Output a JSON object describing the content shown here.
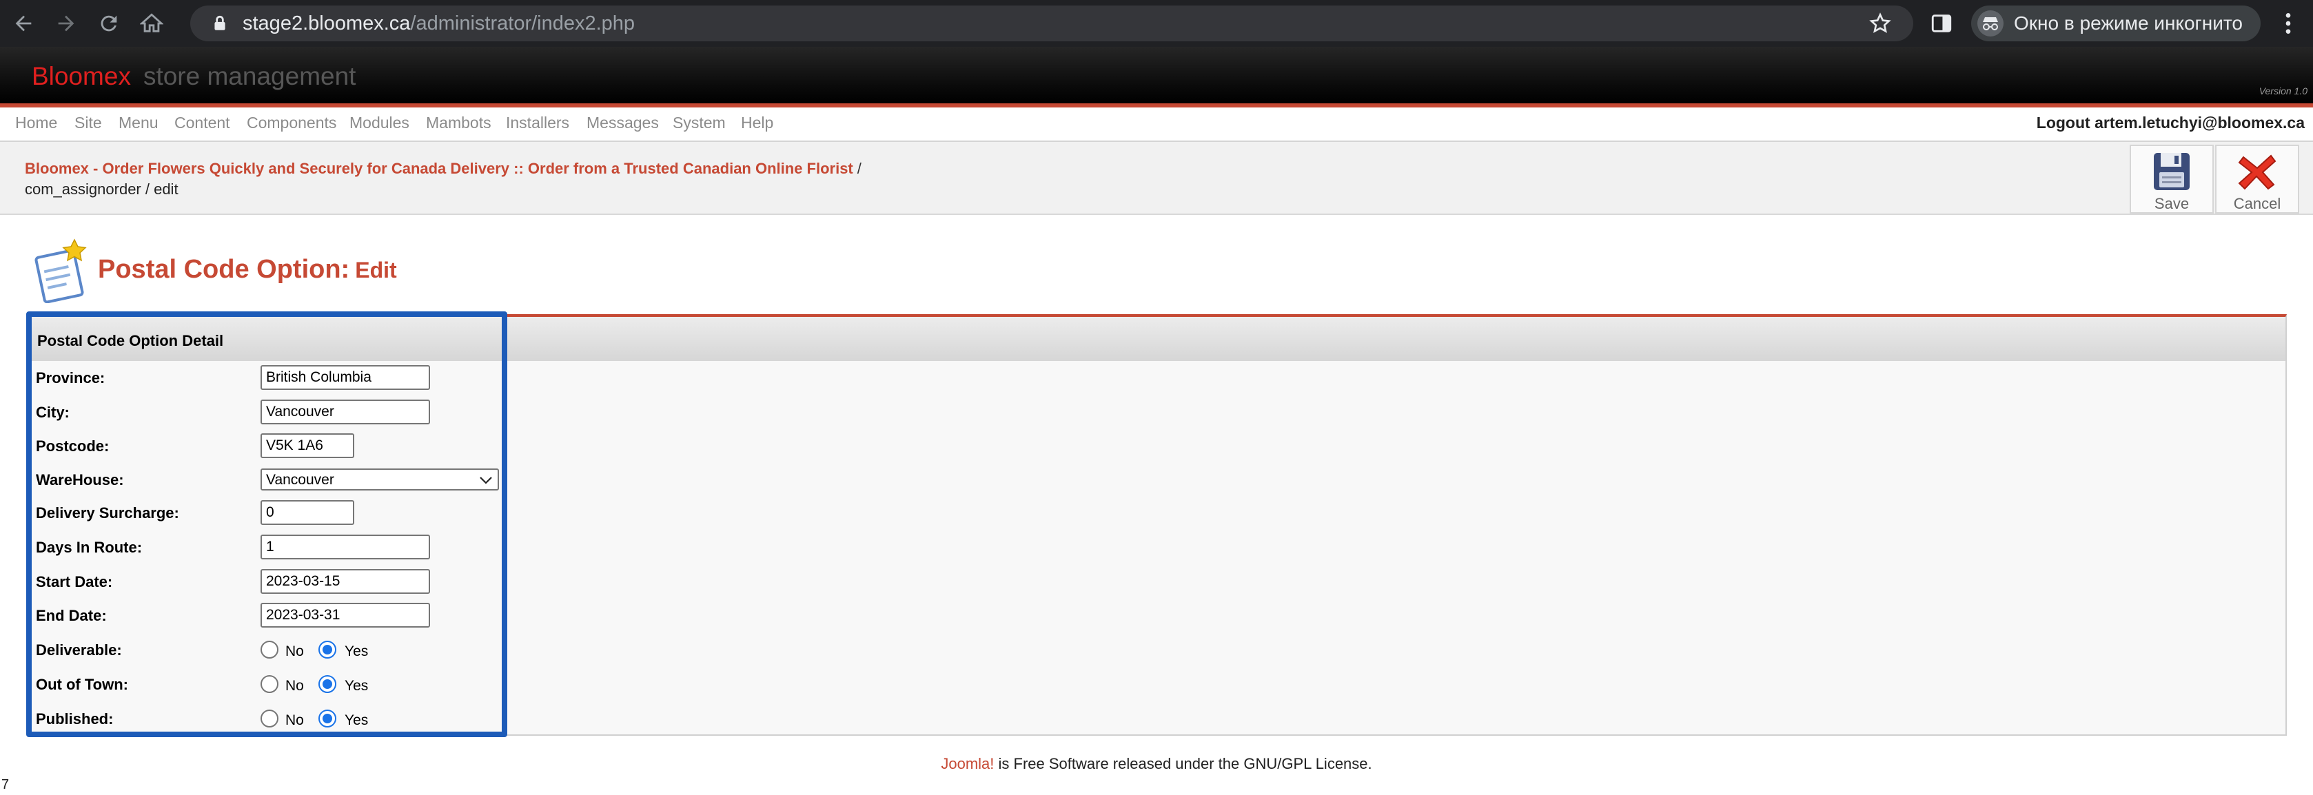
{
  "browser": {
    "url_host": "stage2.bloomex.ca",
    "url_path": "/administrator/index2.php",
    "incognito_label": "Окно в режиме инкогнито"
  },
  "header": {
    "brand_name": "Bloomex",
    "brand_sub": "store management",
    "version": "Version 1.0"
  },
  "menu": {
    "items": [
      "Home",
      "Site",
      "Menu",
      "Content",
      "Components",
      "Modules",
      "Mambots",
      "Installers",
      "Messages",
      "System",
      "Help"
    ],
    "logout": "Logout artem.letuchyi@bloomex.ca"
  },
  "breadcrumb": {
    "site_title": "Bloomex - Order Flowers Quickly and Securely for Canada Delivery :: Order from a Trusted Canadian Online Florist",
    "separator": "/",
    "path": "com_assignorder / edit"
  },
  "toolbar": {
    "save_label": "Save",
    "cancel_label": "Cancel"
  },
  "page": {
    "title": "Postal Code Option:",
    "subtitle": "Edit"
  },
  "form": {
    "section_title": "Postal Code Option Detail",
    "province": {
      "label": "Province:",
      "value": "British Columbia"
    },
    "city": {
      "label": "City:",
      "value": "Vancouver"
    },
    "postcode": {
      "label": "Postcode:",
      "value": "V5K 1A6"
    },
    "warehouse": {
      "label": "WareHouse:",
      "value": "Vancouver"
    },
    "delivery_surcharge": {
      "label": "Delivery Surcharge:",
      "value": "0"
    },
    "days_in_route": {
      "label": "Days In Route:",
      "value": "1"
    },
    "start_date": {
      "label": "Start Date:",
      "value": "2023-03-15"
    },
    "end_date": {
      "label": "End Date:",
      "value": "2023-03-31"
    },
    "deliverable": {
      "label": "Deliverable:",
      "selected": "Yes"
    },
    "out_of_town": {
      "label": "Out of Town:",
      "selected": "Yes"
    },
    "published": {
      "label": "Published:",
      "selected": "Yes"
    },
    "radio_no": "No",
    "radio_yes": "Yes"
  },
  "footer": {
    "joomla": "Joomla!",
    "text": " is Free Software released under the GNU/GPL License."
  },
  "corner_number": "7",
  "colors": {
    "accent": "#c64934",
    "brand_red": "#e0201f",
    "highlight": "#1d5bb8",
    "radio_checked": "#1a73e8"
  },
  "icons": {
    "back": "arrow-left-icon",
    "forward": "arrow-right-icon",
    "reload": "reload-icon",
    "home": "home-icon",
    "lock": "lock-icon",
    "bookmark": "star-icon",
    "side_panel": "side-panel-icon",
    "incognito": "incognito-icon",
    "menu": "kebab-menu-icon",
    "save": "floppy-disk-icon",
    "cancel": "red-x-icon",
    "heading": "notepad-star-icon",
    "select": "chevron-down-icon"
  }
}
